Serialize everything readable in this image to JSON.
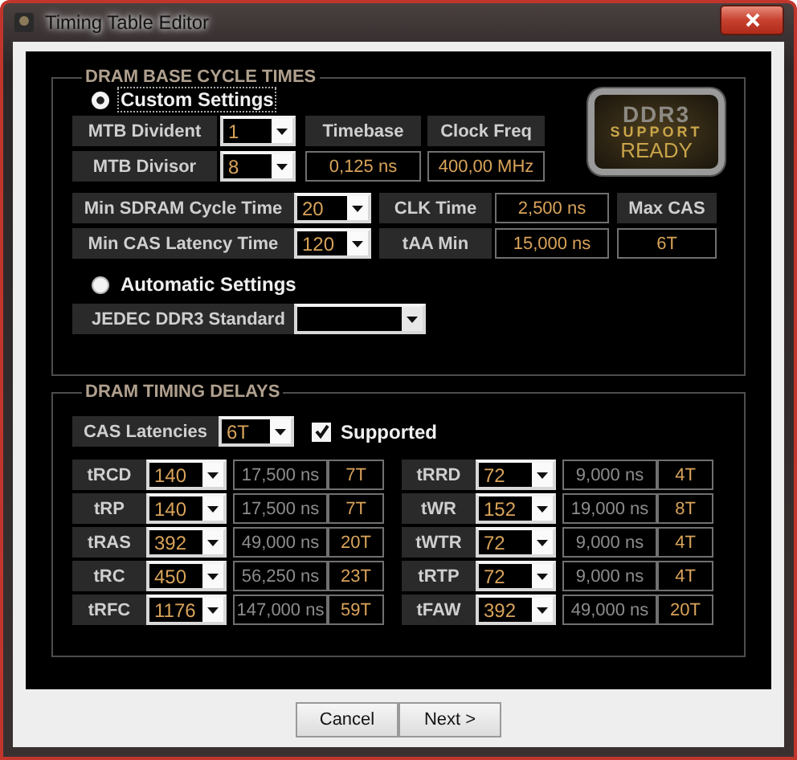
{
  "window": {
    "title": "Timing Table Editor"
  },
  "base_cycle_times": {
    "legend": "DRAM BASE CYCLE TIMES",
    "custom": {
      "label": "Custom Settings",
      "selected": true
    },
    "mtb": [
      {
        "label": "MTB Divident",
        "value": "1",
        "header": "Timebase",
        "header2": "Clock Freq"
      },
      {
        "label": "MTB Divisor",
        "value": "8",
        "reading": "0,125 ns",
        "reading2": "400,00 MHz"
      }
    ],
    "badge": {
      "line1": "DDR3",
      "line2": "SUPPORT",
      "line3": "READY"
    },
    "min_times": [
      {
        "label": "Min SDRAM Cycle Time",
        "value": "20",
        "name": "CLK Time",
        "reading": "2,500 ns",
        "extra": "Max CAS",
        "kind": "label"
      },
      {
        "label": "Min CAS Latency Time",
        "value": "120",
        "name": "tAA Min",
        "reading": "15,000 ns",
        "extra": "6T",
        "kind": "value"
      }
    ],
    "automatic": {
      "label": "Automatic Settings",
      "selected": false
    },
    "jedec": {
      "label": "JEDEC DDR3 Standard"
    }
  },
  "timing_delays": {
    "legend": "DRAM TIMING DELAYS",
    "cas": {
      "label": "CAS Latencies",
      "value": "6T"
    },
    "supported": {
      "label": "Supported",
      "checked": true
    },
    "timings_left": [
      {
        "name": "tRCD",
        "value": "140",
        "ns": "17,500 ns",
        "cycles": "7T"
      },
      {
        "name": "tRP",
        "value": "140",
        "ns": "17,500 ns",
        "cycles": "7T"
      },
      {
        "name": "tRAS",
        "value": "392",
        "ns": "49,000 ns",
        "cycles": "20T"
      },
      {
        "name": "tRC",
        "value": "450",
        "ns": "56,250 ns",
        "cycles": "23T"
      },
      {
        "name": "tRFC",
        "value": "1176",
        "ns": "147,000 ns",
        "cycles": "59T"
      }
    ],
    "timings_right": [
      {
        "name": "tRRD",
        "value": "72",
        "ns": "9,000 ns",
        "cycles": "4T"
      },
      {
        "name": "tWR",
        "value": "152",
        "ns": "19,000 ns",
        "cycles": "8T"
      },
      {
        "name": "tWTR",
        "value": "72",
        "ns": "9,000 ns",
        "cycles": "4T"
      },
      {
        "name": "tRTP",
        "value": "72",
        "ns": "9,000 ns",
        "cycles": "4T"
      },
      {
        "name": "tFAW",
        "value": "392",
        "ns": "49,000 ns",
        "cycles": "20T"
      }
    ]
  },
  "buttons": [
    "Cancel",
    "Next >"
  ]
}
